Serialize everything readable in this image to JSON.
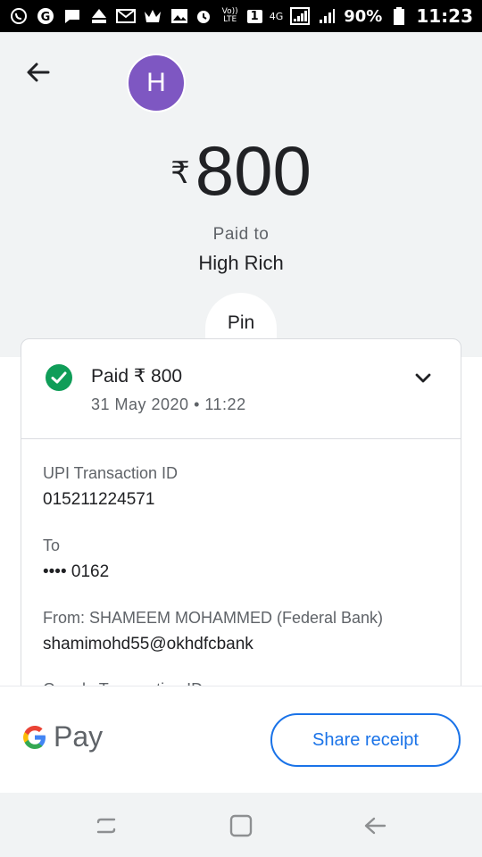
{
  "status_bar": {
    "left_icons": [
      "whatsapp-icon",
      "google-icon",
      "message-icon",
      "mm-icon",
      "gmail-icon",
      "crown-icon",
      "gallery-icon"
    ],
    "volte": "Vo)) LTE",
    "sim": "1",
    "network": "4G",
    "battery": "90%",
    "time": "11:23"
  },
  "header": {
    "avatar_letter": "H",
    "currency_symbol": "₹",
    "amount": "800",
    "paid_to_label": "Paid to",
    "payee_name": "High Rich",
    "pin_label": "Pin"
  },
  "card": {
    "status_line": "Paid ₹ 800",
    "date_line": "31 May 2020 • 11:22",
    "details": [
      {
        "label": "UPI Transaction ID",
        "value": "015211224571"
      },
      {
        "label": "To",
        "value": "•••• 0162"
      },
      {
        "label": "From: SHAMEEM MOHAMMED (Federal Bank)",
        "value": "shamimohd55@okhdfcbank"
      },
      {
        "label": "Google Transaction ID",
        "value": ""
      }
    ]
  },
  "footer": {
    "brand": "Pay",
    "share_label": "Share receipt"
  },
  "colors": {
    "avatar": "#7e57c2",
    "success": "#0f9d58",
    "accent": "#1a73e8"
  }
}
